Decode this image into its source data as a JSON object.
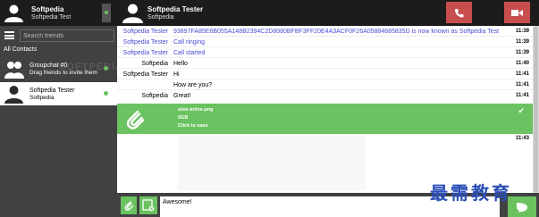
{
  "self": {
    "name": "Softpedia",
    "status_message": "Softpedia Test"
  },
  "search": {
    "placeholder": "Search friends"
  },
  "list_header": "All Contacts",
  "contacts": [
    {
      "name": "Groupchat #0",
      "subtitle": "Drag friends to invite them",
      "watermark": "SOFTPEDIA"
    },
    {
      "name": "Softpedia Tester",
      "subtitle": "Softpedia"
    }
  ],
  "chat_header": {
    "name": "Softpedia Tester",
    "subtitle": "Softpedia"
  },
  "messages": [
    {
      "author": "Softpedia Tester",
      "text": "93897FA85E6B055A148B2394C2D8080BFBF3FF20E4A3ACF0F26A05884685835D is now known as Softpedia Test",
      "time": "11:39",
      "kind": "action"
    },
    {
      "author": "Softpedia Tester",
      "text": "Call ringing",
      "time": "11:39",
      "kind": "action"
    },
    {
      "author": "Softpedia Tester",
      "text": "Call started",
      "time": "11:39",
      "kind": "action"
    },
    {
      "author": "Softpedia",
      "text": "Hello",
      "time": "11:40",
      "kind": "normal"
    },
    {
      "author": "Softpedia Tester",
      "text": "Hi",
      "time": "11:41",
      "kind": "normal"
    },
    {
      "author": "",
      "text": "How are you?",
      "time": "11:41",
      "kind": "normal"
    },
    {
      "author": "Softpedia",
      "text": "Great!",
      "time": "11:41",
      "kind": "normal"
    }
  ],
  "file_transfer": {
    "filename": "utox-inline.png",
    "size": "0GB",
    "action": "Click to save",
    "time": "11:43"
  },
  "compose": {
    "value": "Awesome!"
  },
  "watermark_cn": "最需教育",
  "colors": {
    "accent_green": "#6bc260",
    "call_red": "#c84e4e",
    "action_blue": "#4b4bd2",
    "dark": "#1c1c1c",
    "sidebar": "#414141"
  },
  "icons": [
    "user-avatar-icon",
    "group-avatar-icon",
    "hamburger-icon",
    "phone-icon",
    "video-icon",
    "paperclip-icon",
    "screenshot-icon",
    "send-icon",
    "check-icon"
  ]
}
